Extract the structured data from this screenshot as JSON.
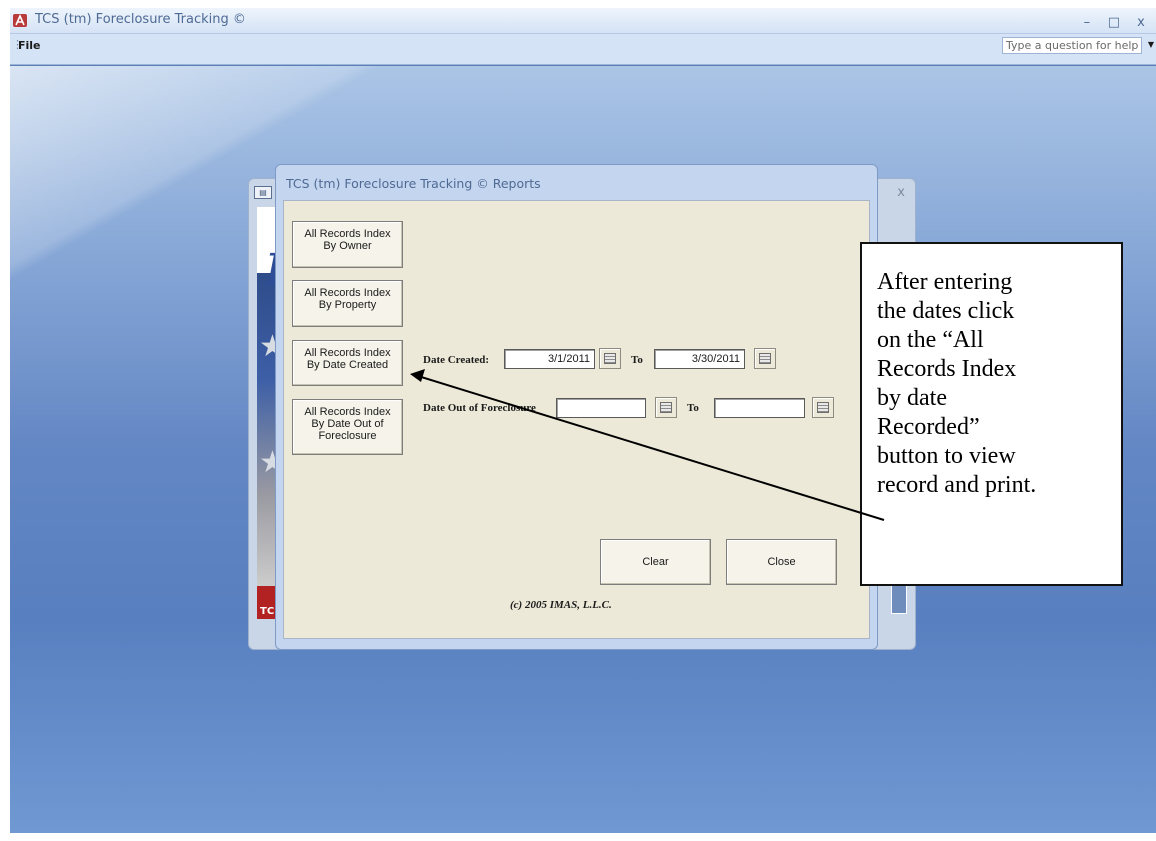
{
  "window": {
    "title": "TCS (tm) Foreclosure Tracking ©",
    "controls": {
      "minimize": "–",
      "restore": "□",
      "close": "x"
    }
  },
  "menu": {
    "file": "File",
    "help_placeholder": "Type a question for help"
  },
  "background_form": {
    "close": "x",
    "banner_letter": "I",
    "banner_tag": "TC"
  },
  "dialog": {
    "title": "TCS (tm) Foreclosure Tracking ©  Reports",
    "buttons": {
      "by_owner": [
        "All Records Index",
        "By Owner"
      ],
      "by_property": [
        "All Records Index",
        "By Property"
      ],
      "by_date_created": [
        "All Records Index",
        "By Date Created"
      ],
      "by_date_out": [
        "All Records Index",
        "By Date Out of",
        "Foreclosure"
      ]
    },
    "date_created": {
      "label": "Date Created:",
      "from": "3/1/2011",
      "to_label": "To",
      "to": "3/30/2011"
    },
    "date_out": {
      "label": "Date Out of Foreclosure",
      "from": "",
      "to_label": "To",
      "to": ""
    },
    "clear": "Clear",
    "close": "Close",
    "copyright": "(c) 2005 IMAS, L.L.C."
  },
  "callout": {
    "lines": [
      "After entering",
      "the dates click",
      "on the “All",
      "Records Index",
      "by date",
      "Recorded”",
      "button to view",
      "record and print."
    ]
  },
  "colors": {
    "workspace": "#5b80b8",
    "dialog_body": "#ece9d8",
    "title_text": "#4e6a94"
  }
}
